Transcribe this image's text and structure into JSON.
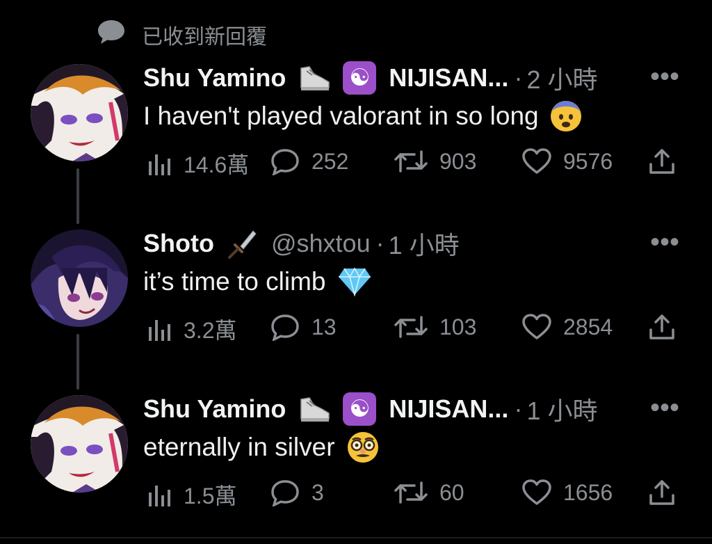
{
  "reply_banner": {
    "icon": "speech-bubble-icon",
    "text": "已收到新回覆"
  },
  "colors": {
    "background": "#000000",
    "text": "#e7e9ea",
    "muted": "#8b8f94",
    "community_badge": "#9b4fc8"
  },
  "tweets": [
    {
      "author": "Shu Yamino",
      "name_emoji": "shoe-icon",
      "community": "NIJISAN...",
      "time": "2 小時",
      "text": "I haven't played valorant in so long",
      "text_emoji": "fearful-face-icon",
      "stats": {
        "views": "14.6萬",
        "replies": "252",
        "reposts": "903",
        "likes": "9576"
      }
    },
    {
      "author": "Shoto",
      "name_emoji": "dagger-icon",
      "handle": "@shxtou",
      "time": "1 小時",
      "text": "it’s time to climb",
      "text_emoji": "gem-icon",
      "stats": {
        "views": "3.2萬",
        "replies": "13",
        "reposts": "103",
        "likes": "2854"
      }
    },
    {
      "author": "Shu Yamino",
      "name_emoji": "shoe-icon",
      "community": "NIJISAN...",
      "time": "1 小時",
      "text": "eternally in silver",
      "text_emoji": "disguised-face-icon",
      "stats": {
        "views": "1.5萬",
        "replies": "3",
        "reposts": "60",
        "likes": "1656"
      }
    }
  ]
}
